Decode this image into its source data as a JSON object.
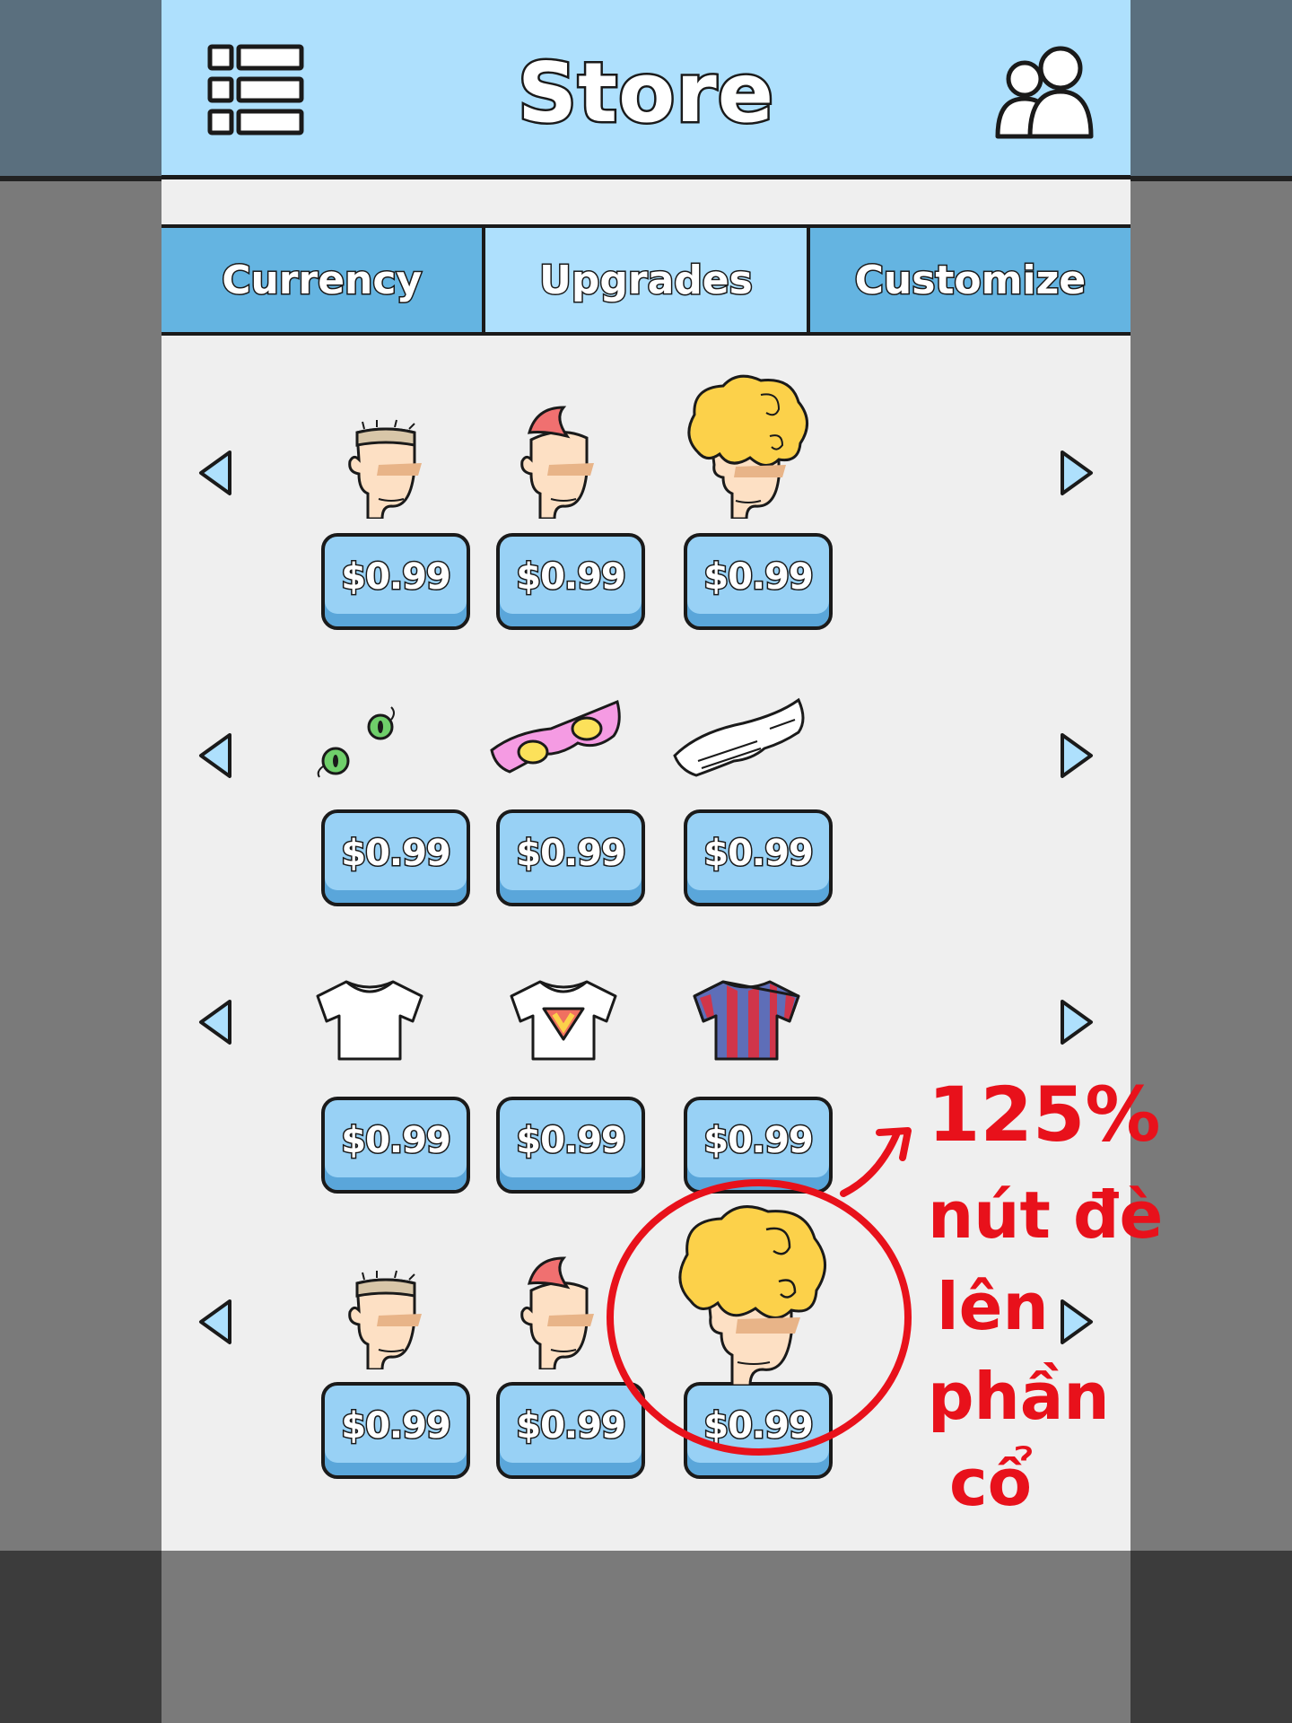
{
  "header": {
    "title": "Store"
  },
  "tabs": [
    {
      "label": "Currency",
      "active": false
    },
    {
      "label": "Upgrades",
      "active": true
    },
    {
      "label": "Customize",
      "active": false
    }
  ],
  "rows": [
    {
      "category": "hair",
      "items": [
        {
          "name": "buzz-cut-hair",
          "price": "$0.99"
        },
        {
          "name": "red-mohawk-hair",
          "price": "$0.99"
        },
        {
          "name": "blonde-curly-hair",
          "price": "$0.99"
        }
      ]
    },
    {
      "category": "eyewear",
      "items": [
        {
          "name": "green-eyes",
          "price": "$0.99"
        },
        {
          "name": "pink-glasses",
          "price": "$0.99"
        },
        {
          "name": "white-shutter-shades",
          "price": "$0.99"
        }
      ]
    },
    {
      "category": "shirt",
      "items": [
        {
          "name": "white-tshirt",
          "price": "$0.99"
        },
        {
          "name": "super-v-tshirt",
          "price": "$0.99"
        },
        {
          "name": "striped-jersey",
          "price": "$0.99"
        }
      ]
    },
    {
      "category": "hair-enlarged",
      "items": [
        {
          "name": "buzz-cut-hair",
          "price": "$0.99"
        },
        {
          "name": "red-mohawk-hair",
          "price": "$0.99"
        },
        {
          "name": "blonde-curly-hair-enlarged",
          "price": "$0.99"
        }
      ]
    }
  ],
  "annotation": {
    "line1": "125%",
    "line2": "nút đè",
    "line3": "lên",
    "line4": "phần",
    "line5": "cổ",
    "color": "#e8111b"
  },
  "colors": {
    "header": "#aee0fd",
    "tab": "#64b4e1",
    "button": "#98d1f5",
    "panel": "#efefef"
  }
}
